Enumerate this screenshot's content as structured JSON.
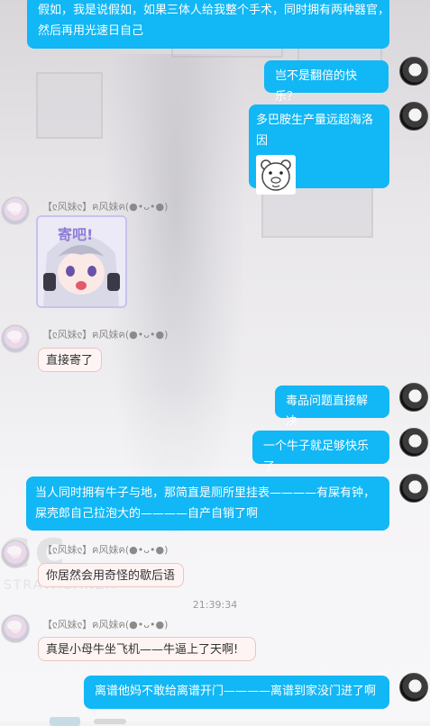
{
  "messages": [
    {
      "side": "right",
      "text_lines": [
        "假如，我是说假如，如果三体人给我整个手术，同时拥有两种器官，",
        "然后再用光速日自己"
      ]
    },
    {
      "side": "right",
      "text": "岂不是翻倍的快乐？"
    },
    {
      "side": "right",
      "text": "多巴胺生产量远超海洛因",
      "has_sticker": true,
      "sticker_icon": "bear-meme-sticker"
    },
    {
      "side": "left",
      "sender": "【ჺ风妹ჺ】ฅ风妹ฅ(●•ᴗ•●)",
      "has_sticker": true,
      "sticker_text": "寄吧!",
      "sticker_icon": "anime-girl-sticker"
    },
    {
      "side": "left",
      "sender": "【ჺ风妹ჺ】ฅ风妹ฅ(●•ᴗ•●)",
      "text": "直接寄了"
    },
    {
      "side": "right",
      "text": "毒品问题直接解决"
    },
    {
      "side": "right",
      "text": "一个牛子就足够快乐了"
    },
    {
      "side": "right",
      "text_lines": [
        "当人同时拥有牛子与地，那简直是厕所里挂表————有屎有钟，",
        "屎壳郎自己拉泡大的————自产自销了啊"
      ]
    },
    {
      "side": "left",
      "sender": "【ჺ风妹ჺ】ฅ风妹ฅ(●•ᴗ•●)",
      "text": "你居然会用奇怪的歇后语"
    },
    {
      "side": "left",
      "sender": "【ჺ风妹ჺ】ฅ风妹ฅ(●•ᴗ•●)",
      "text": "真是小母牛坐飞机——牛逼上了天啊!"
    },
    {
      "side": "right",
      "text": "离谱他妈不敢给离谱开门————离谱到家没门进了啊"
    }
  ],
  "timestamp": "21:39:34",
  "background": {
    "watermark": "cc",
    "watermark_sub": "STRAVAGANZA"
  },
  "colors": {
    "self_bubble": "#12b7f5",
    "other_bubble": "#fdf4f3"
  }
}
